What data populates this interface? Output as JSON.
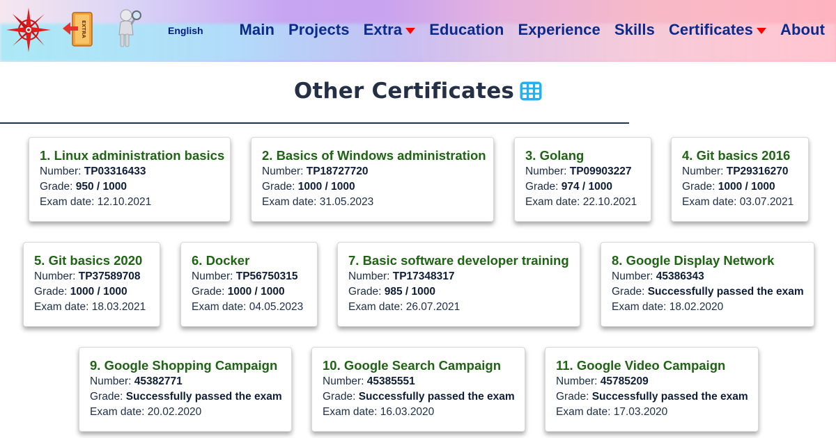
{
  "header": {
    "language": "English",
    "nav": [
      {
        "label": "Main",
        "dropdown": false
      },
      {
        "label": "Projects",
        "dropdown": false
      },
      {
        "label": "Extra",
        "dropdown": true
      },
      {
        "label": "Education",
        "dropdown": false
      },
      {
        "label": "Experience",
        "dropdown": false
      },
      {
        "label": "Skills",
        "dropdown": false
      },
      {
        "label": "Certificates",
        "dropdown": true
      },
      {
        "label": "About",
        "dropdown": false
      }
    ],
    "extra_icon_text": "EXTRA",
    "icons": [
      "compass-rose-logo-icon",
      "extra-exit-icon",
      "person-magnifier-icon"
    ]
  },
  "page": {
    "title": "Other Certificates",
    "title_icon": "grid-icon"
  },
  "labels": {
    "number": "Number: ",
    "grade": "Grade: ",
    "exam_date": "Exam date: "
  },
  "certificates": [
    {
      "title": "1. Linux administration basics",
      "number": "TP03316433",
      "grade": "950 / 1000",
      "exam_date": "12.10.2021"
    },
    {
      "title": "2. Basics of Windows administration",
      "number": "TP18727720",
      "grade": "1000 / 1000",
      "exam_date": "31.05.2023"
    },
    {
      "title": "3. Golang",
      "number": "TP09903227",
      "grade": "974 / 1000",
      "exam_date": "22.10.2021"
    },
    {
      "title": "4. Git basics 2016",
      "number": "TP29316270",
      "grade": "1000 / 1000",
      "exam_date": "03.07.2021"
    },
    {
      "title": "5. Git basics 2020",
      "number": "TP37589708",
      "grade": "1000 / 1000",
      "exam_date": "18.03.2021"
    },
    {
      "title": "6. Docker",
      "number": "TP56750315",
      "grade": "1000 / 1000",
      "exam_date": "04.05.2023"
    },
    {
      "title": "7. Basic software developer training",
      "number": "TP17348317",
      "grade": "985 / 1000",
      "exam_date": "26.07.2021"
    },
    {
      "title": "8. Google Display Network",
      "number": "45386343",
      "grade": "Successfully passed the exam",
      "exam_date": "18.02.2020"
    },
    {
      "title": "9. Google Shopping Campaign",
      "number": "45382771",
      "grade": "Successfully passed the exam",
      "exam_date": "20.02.2020"
    },
    {
      "title": "10. Google Search Campaign",
      "number": "45385551",
      "grade": "Successfully passed the exam",
      "exam_date": "16.03.2020"
    },
    {
      "title": "11. Google Video Campaign",
      "number": "45785209",
      "grade": "Successfully passed the exam",
      "exam_date": "17.03.2020"
    }
  ],
  "colors": {
    "card_title": "#1f6314",
    "nav_text": "#0c2a8c",
    "dropdown_caret": "#ff0000",
    "page_title": "#233046",
    "grid_icon": "#22b2f0"
  }
}
